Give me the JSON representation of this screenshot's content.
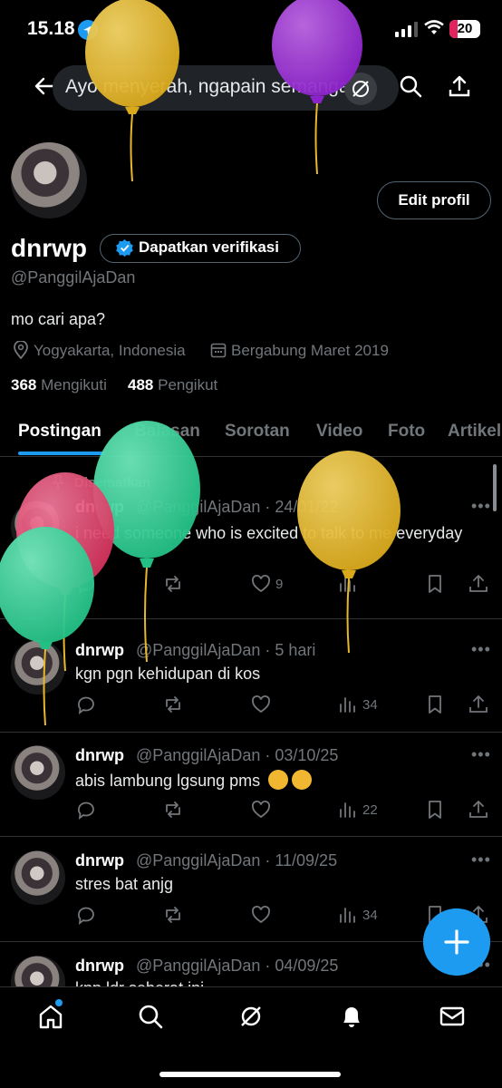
{
  "status_bar": {
    "time": "15.18",
    "battery": "20"
  },
  "header": {
    "search_text": "Ayo menyerah, ngapain semangat"
  },
  "profile": {
    "edit_button": "Edit profil",
    "display_name": "dnrwp",
    "verify_label": "Dapatkan verifikasi",
    "handle": "@PanggilAjaDan",
    "bio": "mo cari apa?",
    "location": "Yogyakarta, Indonesia",
    "joined": "Bergabung Maret 2019",
    "following_count": "368",
    "following_label": "Mengikuti",
    "followers_count": "488",
    "followers_label": "Pengikut"
  },
  "tabs": [
    "Postingan",
    "Balasan",
    "Sorotan",
    "Video",
    "Foto",
    "Artikel"
  ],
  "posts": [
    {
      "pinned_label": "Disematkan",
      "name": "dnrwp",
      "handle_date": "@PanggilAjaDan · 24/01/22",
      "text": "i need someone who is excited to talk to me everyday",
      "likes": "9",
      "views": ""
    },
    {
      "name": "dnrwp",
      "handle_date": "@PanggilAjaDan · 5 hari",
      "text": "kgn pgn kehidupan di kos",
      "views": "34"
    },
    {
      "name": "dnrwp",
      "handle_date": "@PanggilAjaDan · 03/10/25",
      "text": "abis lambung lgsung pms",
      "views": "22"
    },
    {
      "name": "dnrwp",
      "handle_date": "@PanggilAjaDan · 11/09/25",
      "text": "stres bat anjg",
      "views": "34"
    },
    {
      "name": "dnrwp",
      "handle_date": "@PanggilAjaDan · 04/09/25",
      "text": "knp ldr seberat ini"
    }
  ],
  "colors": {
    "accent": "#1d9bf0",
    "balloon_yellow": "#e6b82a",
    "balloon_purple": "#9b2fd6",
    "balloon_green": "#2fcf94",
    "balloon_red": "#e0416a"
  }
}
